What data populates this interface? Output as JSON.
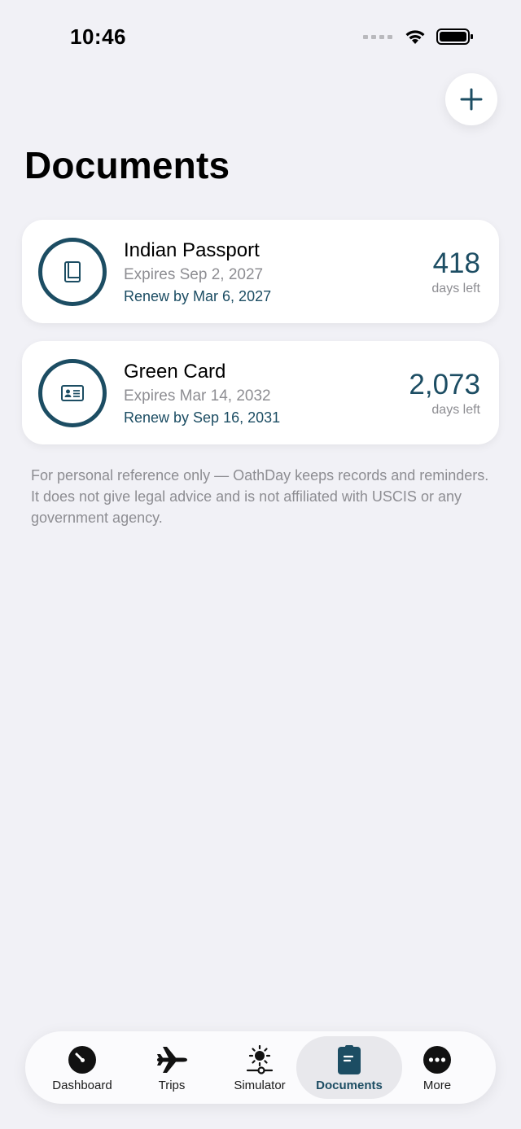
{
  "status_bar": {
    "time": "10:46"
  },
  "header": {
    "title": "Documents"
  },
  "documents": [
    {
      "name": "Indian Passport",
      "expires": "Expires Sep 2, 2027",
      "renew": "Renew by Mar 6, 2027",
      "days": "418",
      "days_label": "days left",
      "icon": "book-icon"
    },
    {
      "name": "Green Card",
      "expires": "Expires Mar 14, 2032",
      "renew": "Renew by Sep 16, 2031",
      "days": "2,073",
      "days_label": "days left",
      "icon": "id-card-icon"
    }
  ],
  "disclaimer": "For personal reference only — OathDay keeps records and reminders. It does not give legal advice and is not affiliated with USCIS or any government agency.",
  "tabs": [
    {
      "label": "Dashboard",
      "icon": "gauge-icon"
    },
    {
      "label": "Trips",
      "icon": "airplane-icon"
    },
    {
      "label": "Simulator",
      "icon": "sun-slider-icon"
    },
    {
      "label": "Documents",
      "icon": "document-icon",
      "active": true
    },
    {
      "label": "More",
      "icon": "ellipsis-icon"
    }
  ],
  "colors": {
    "accent": "#1c4d63",
    "background": "#f1f1f6",
    "secondary_text": "#8d8d92"
  }
}
